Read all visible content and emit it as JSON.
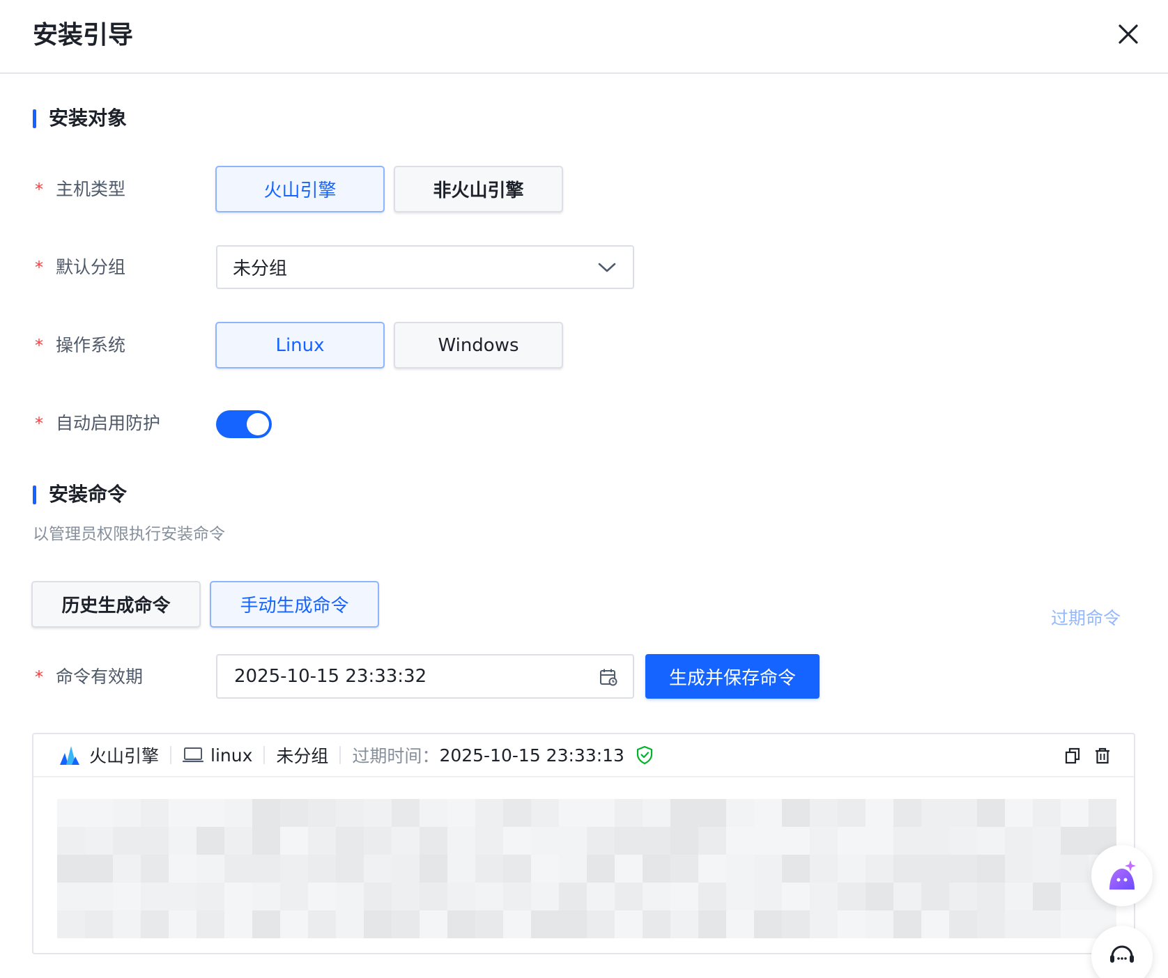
{
  "dialog": {
    "title": "安装引导"
  },
  "section_target": {
    "title": "安装对象"
  },
  "host_type": {
    "label": "主机类型",
    "options": [
      "火山引擎",
      "非火山引擎"
    ],
    "selected": "火山引擎"
  },
  "default_group": {
    "label": "默认分组",
    "value": "未分组"
  },
  "os": {
    "label": "操作系统",
    "options": [
      "Linux",
      "Windows"
    ],
    "selected": "Linux"
  },
  "auto_protect": {
    "label": "自动启用防护",
    "enabled": true
  },
  "section_command": {
    "title": "安装命令",
    "hint": "以管理员权限执行安装命令"
  },
  "command_tabs": {
    "options": [
      "历史生成命令",
      "手动生成命令"
    ],
    "selected": "手动生成命令"
  },
  "expired_link": "过期命令",
  "validity": {
    "label": "命令有效期",
    "value": "2025-10-15 23:33:32"
  },
  "generate_button": "生成并保存命令",
  "command_card": {
    "platform": "火山引擎",
    "os": "linux",
    "group": "未分组",
    "expire_label": "过期时间：",
    "expire_value": "2025-10-15 23:33:13"
  },
  "colors": {
    "accent": "#1664ff",
    "required": "#f53f3f",
    "shield": "#00b42a"
  },
  "icons": [
    "close-icon",
    "chevron-down-icon",
    "calendar-icon",
    "volcano-logo-icon",
    "laptop-icon",
    "shield-check-icon",
    "copy-icon",
    "trash-icon",
    "ai-assistant-icon",
    "customer-service-icon"
  ]
}
